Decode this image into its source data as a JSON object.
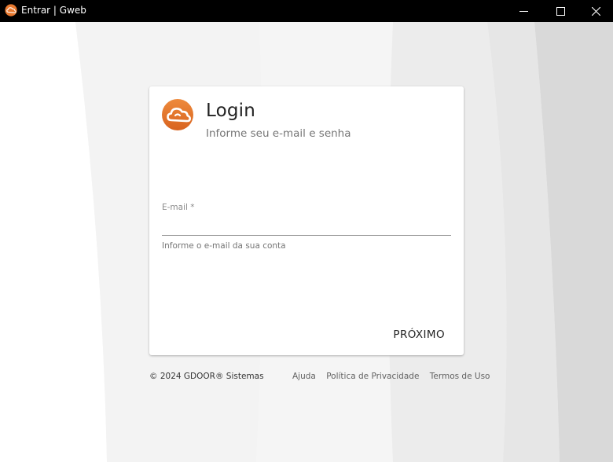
{
  "window": {
    "title": "Entrar | Gweb",
    "icon": "gweb-logo-icon"
  },
  "colors": {
    "brand": "#e8792f",
    "brand_dark": "#c8561a",
    "titlebar": "#000000"
  },
  "login": {
    "title": "Login",
    "subtitle": "Informe seu e-mail e senha",
    "email_label": "E-mail *",
    "email_value": "",
    "email_hint": "Informe o e-mail da sua conta",
    "next_label": "PRÓXIMO"
  },
  "footer": {
    "copyright": "© 2024 GDOOR® Sistemas",
    "links": [
      "Ajuda",
      "Política de Privacidade",
      "Termos de Uso"
    ]
  }
}
